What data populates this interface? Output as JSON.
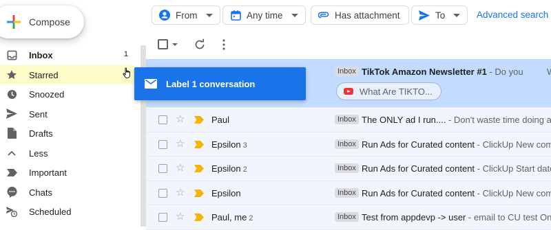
{
  "compose": {
    "label": "Compose"
  },
  "nav": [
    {
      "label": "Inbox",
      "count": "1",
      "icon": "inbox-icon"
    },
    {
      "label": "Starred",
      "count": "",
      "icon": "star-icon"
    },
    {
      "label": "Snoozed",
      "count": "",
      "icon": "clock-icon"
    },
    {
      "label": "Sent",
      "count": "",
      "icon": "send-icon"
    },
    {
      "label": "Drafts",
      "count": "",
      "icon": "draft-icon"
    },
    {
      "label": "Less",
      "count": "",
      "icon": "chevron-up-icon"
    },
    {
      "label": "Important",
      "count": "",
      "icon": "important-icon"
    },
    {
      "label": "Chats",
      "count": "",
      "icon": "chat-icon"
    },
    {
      "label": "Scheduled",
      "count": "",
      "icon": "scheduled-icon"
    }
  ],
  "filters": {
    "from": "From",
    "any_time": "Any time",
    "has_attachment": "Has attachment",
    "to": "To",
    "advanced": "Advanced search"
  },
  "drag": {
    "label": "Label 1 conversation"
  },
  "selected_email": {
    "tag": "Inbox",
    "subject": "TikTok Amazon Newsletter #1",
    "snippet": " - Do you",
    "extra": "W",
    "attachment": "What Are TIKTO..."
  },
  "emails": [
    {
      "sender": "Paul",
      "count": "",
      "tag": "Inbox",
      "subject": "The ONLY ad I run....",
      "snippet": " - Don't waste time doing any"
    },
    {
      "sender": "Epsilon",
      "count": "3",
      "tag": "Inbox",
      "subject": "Run Ads for Curated content",
      "snippet": " - ClickUp New comm"
    },
    {
      "sender": "Epsilon",
      "count": "2",
      "tag": "Inbox",
      "subject": "Run Ads for Curated content",
      "snippet": " - ClickUp Start date"
    },
    {
      "sender": "Epsilon",
      "count": "",
      "tag": "Inbox",
      "subject": "Run Ads for Curated content",
      "snippet": " - ClickUp New comm"
    },
    {
      "sender": "Paul, me",
      "count": "2",
      "tag": "Inbox",
      "subject": "Test from appdevp -> user",
      "snippet": " - email to CU test On"
    }
  ],
  "colors": {
    "accent": "#1a73e8",
    "selected_row": "#c2dbff",
    "hover_nav": "#fefcc8",
    "important": "#f4b400"
  }
}
